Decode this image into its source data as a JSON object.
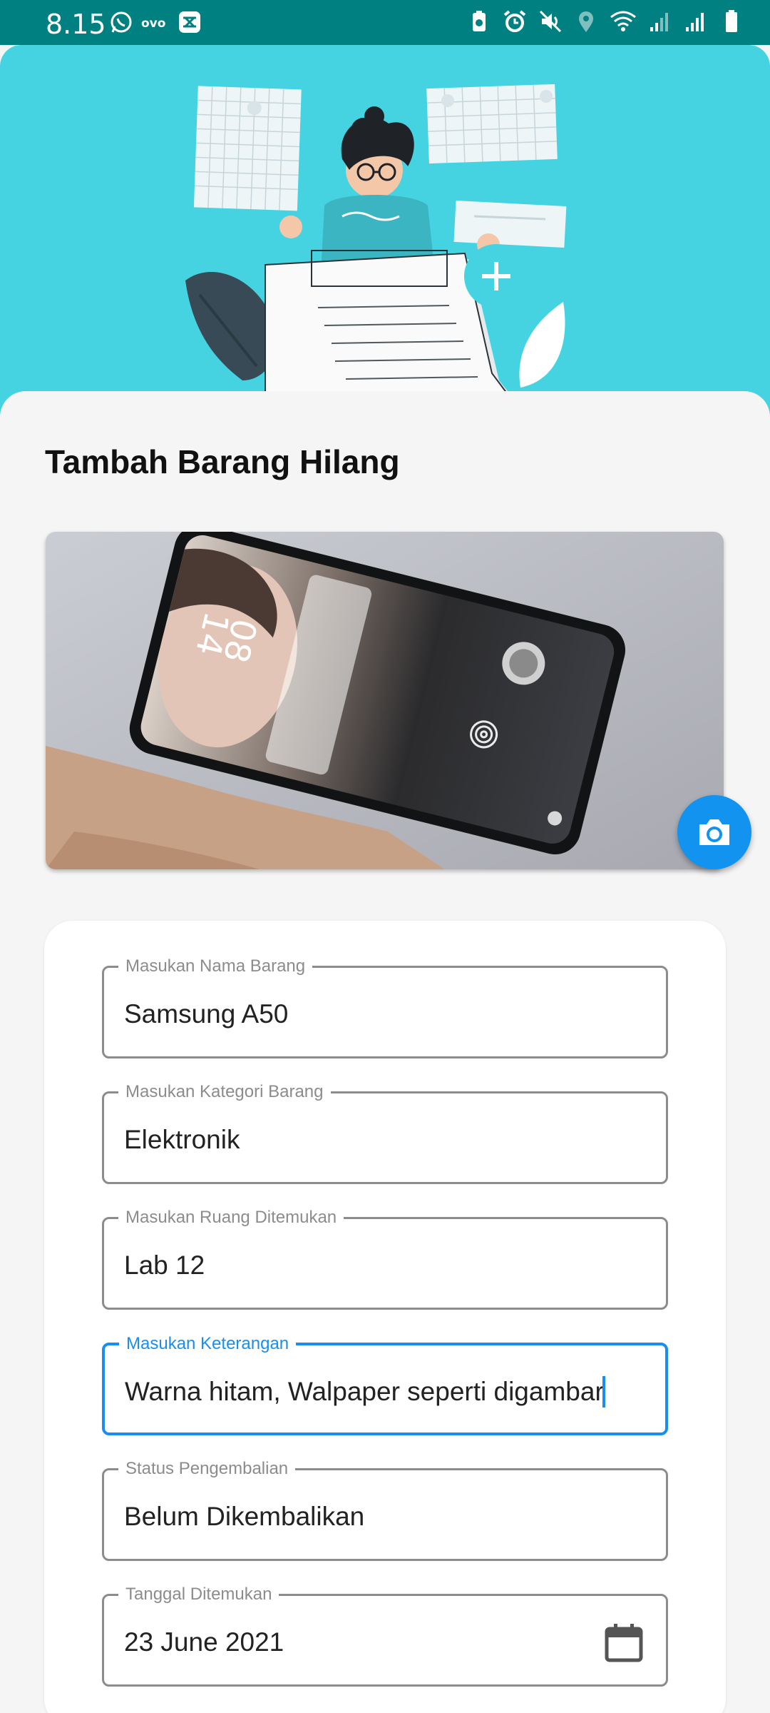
{
  "status_bar": {
    "time": "8.15",
    "left_icons": [
      "whatsapp-icon",
      "ovo-icon",
      "capcut-icon"
    ],
    "right_icons": [
      "battery-saver-icon",
      "alarm-icon",
      "mute-icon",
      "location-icon",
      "wifi-icon",
      "signal-icon",
      "signal-icon",
      "battery-icon"
    ]
  },
  "page": {
    "title": "Tambah Barang Hilang"
  },
  "photo": {
    "clock_hours": "08",
    "clock_minutes": "14"
  },
  "form": {
    "fields": [
      {
        "label": "Masukan Nama Barang",
        "value": "Samsung A50"
      },
      {
        "label": "Masukan Kategori Barang",
        "value": "Elektronik"
      },
      {
        "label": "Masukan Ruang Ditemukan",
        "value": "Lab 12"
      },
      {
        "label": "Masukan Keterangan",
        "value": "Warna hitam, Walpaper seperti digambar"
      },
      {
        "label": "Status Pengembalian",
        "value": "Belum Dikembalikan"
      },
      {
        "label": "Tanggal Ditemukan",
        "value": "23 June 2021"
      }
    ]
  },
  "colors": {
    "status_bar": "#008080",
    "hero_bg": "#45d3e2",
    "accent": "#1a8ef0",
    "fab": "#1293f0"
  },
  "icons": {
    "camera_button": "camera-icon",
    "date_picker": "calendar-icon"
  }
}
